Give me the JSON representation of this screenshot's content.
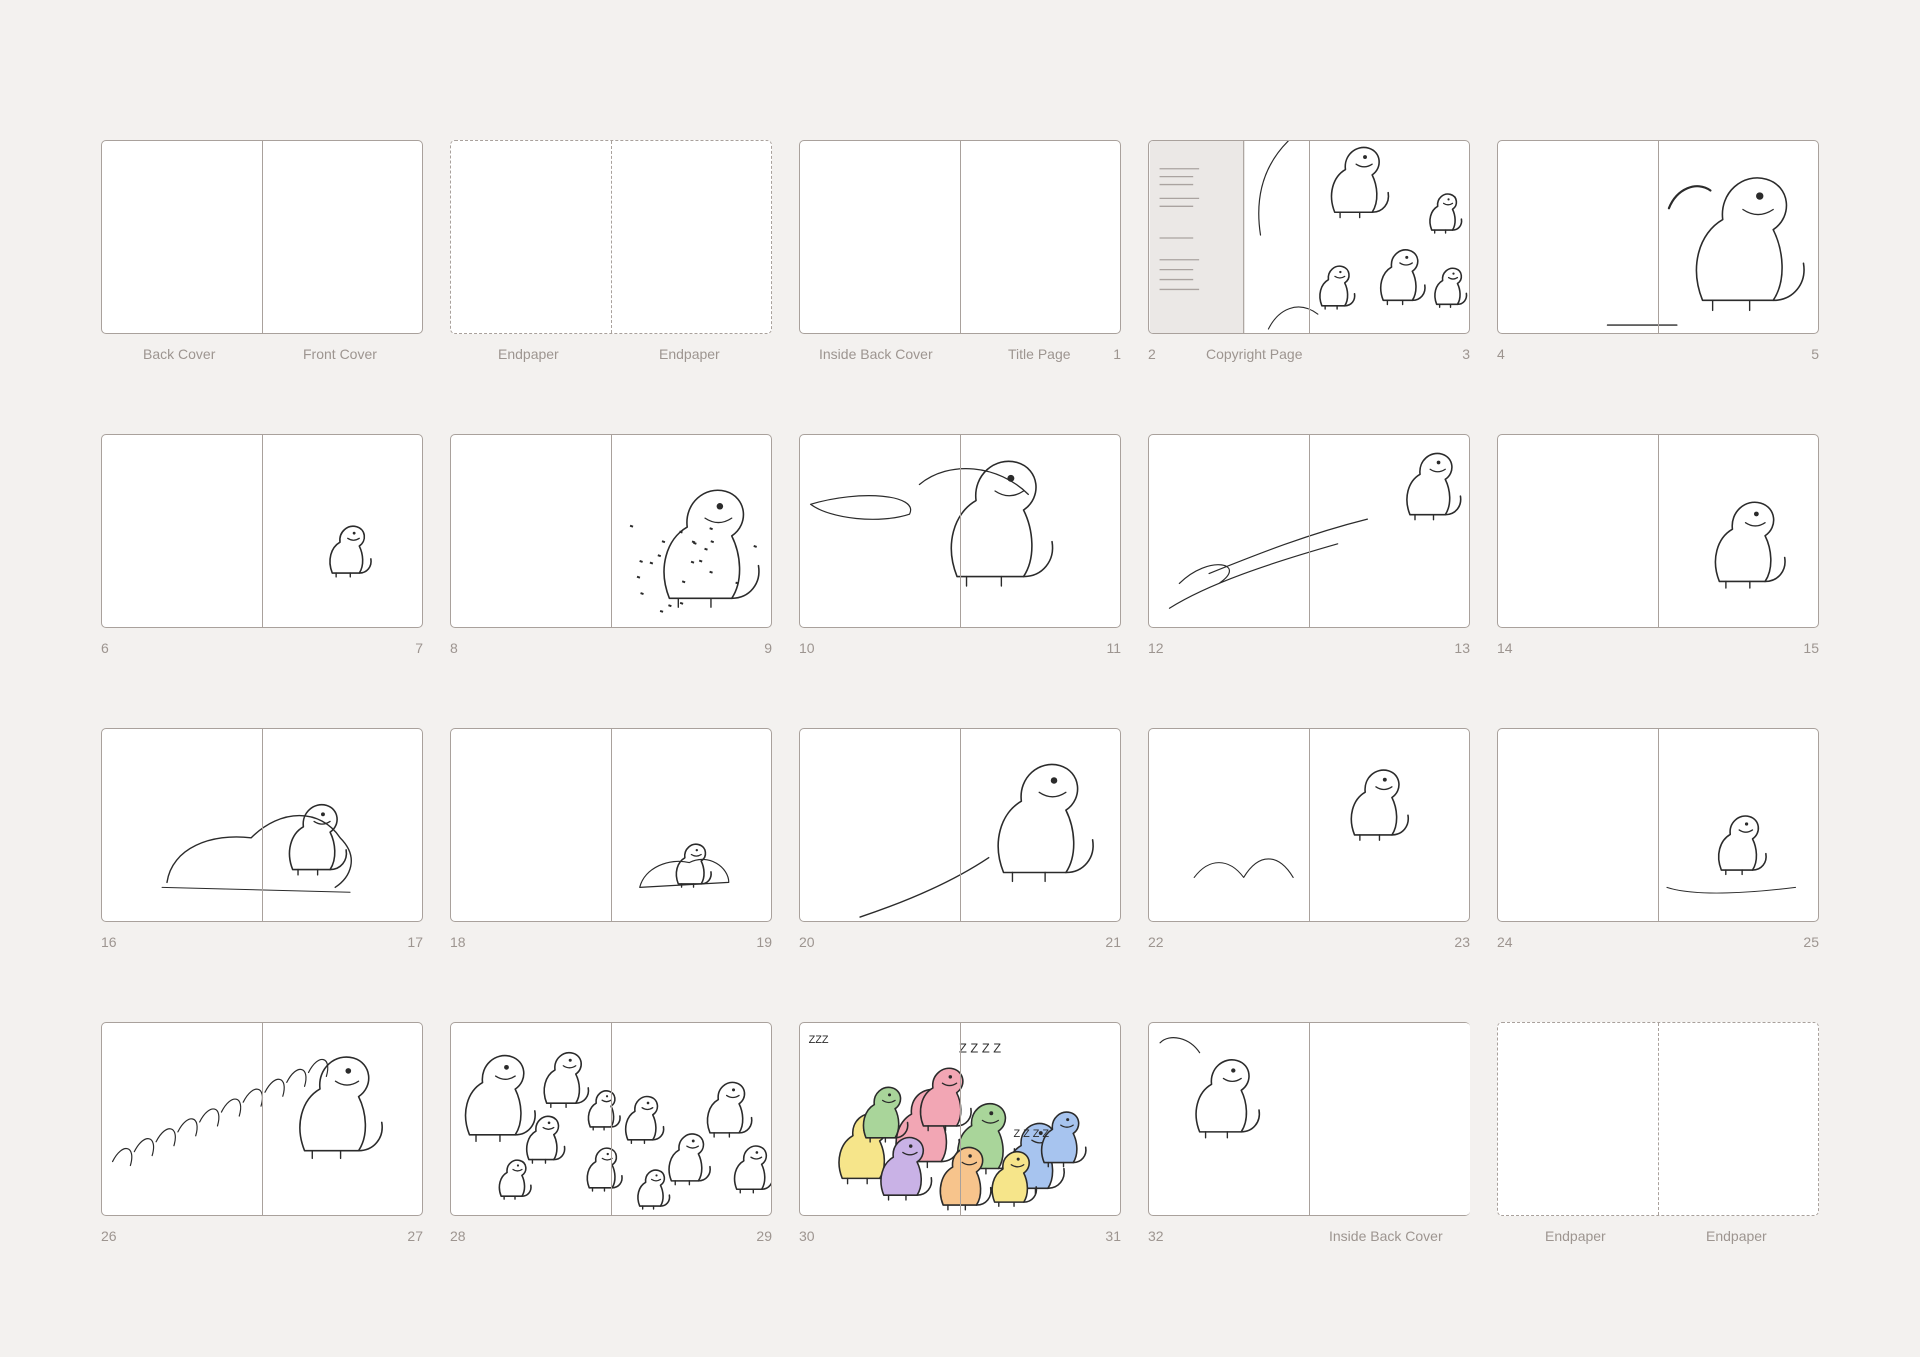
{
  "spreads": [
    {
      "left_label": "Back Cover",
      "right_label": "Front Cover",
      "left_num": "",
      "right_num": "",
      "style": "solid",
      "art": ""
    },
    {
      "left_label": "Endpaper",
      "right_label": "Endpaper",
      "left_num": "",
      "right_num": "",
      "style": "dashed",
      "art": ""
    },
    {
      "left_label": "Inside Back Cover",
      "right_label": "Title Page",
      "left_num": "",
      "right_num": "1",
      "style": "solid",
      "art": ""
    },
    {
      "left_label": "",
      "right_label": "Copyright Page",
      "left_num": "2",
      "right_num": "3",
      "style": "solid",
      "art": "copyright"
    },
    {
      "left_label": "",
      "right_label": "",
      "left_num": "4",
      "right_num": "5",
      "style": "solid",
      "art": "roar"
    },
    {
      "left_label": "",
      "right_label": "",
      "left_num": "6",
      "right_num": "7",
      "style": "solid",
      "art": "small"
    },
    {
      "left_label": "",
      "right_label": "",
      "left_num": "8",
      "right_num": "9",
      "style": "solid",
      "art": "sneeze"
    },
    {
      "left_label": "",
      "right_label": "",
      "left_num": "10",
      "right_num": "11",
      "style": "solid",
      "art": "tumble"
    },
    {
      "left_label": "",
      "right_label": "",
      "left_num": "12",
      "right_num": "13",
      "style": "solid",
      "art": "wind"
    },
    {
      "left_label": "",
      "right_label": "",
      "left_num": "14",
      "right_num": "15",
      "style": "solid",
      "art": "sitting"
    },
    {
      "left_label": "",
      "right_label": "",
      "left_num": "16",
      "right_num": "17",
      "style": "solid",
      "art": "yawn"
    },
    {
      "left_label": "",
      "right_label": "",
      "left_num": "18",
      "right_num": "19",
      "style": "solid",
      "art": "lying"
    },
    {
      "left_label": "",
      "right_label": "",
      "left_num": "20",
      "right_num": "21",
      "style": "solid",
      "art": "bigface"
    },
    {
      "left_label": "",
      "right_label": "",
      "left_num": "22",
      "right_num": "23",
      "style": "solid",
      "art": "jump"
    },
    {
      "left_label": "",
      "right_label": "",
      "left_num": "24",
      "right_num": "25",
      "style": "solid",
      "art": "rolling"
    },
    {
      "left_label": "",
      "right_label": "",
      "left_num": "26",
      "right_num": "27",
      "style": "solid",
      "art": "splash"
    },
    {
      "left_label": "",
      "right_label": "",
      "left_num": "28",
      "right_num": "29",
      "style": "solid",
      "art": "crowd"
    },
    {
      "left_label": "",
      "right_label": "",
      "left_num": "30",
      "right_num": "31",
      "style": "solid",
      "art": "pile"
    },
    {
      "left_label": "",
      "right_label": "Inside Back Cover",
      "left_num": "32",
      "right_num": "",
      "style": "solid-right-dashed",
      "art": "grandpa"
    },
    {
      "left_label": "Endpaper",
      "right_label": "Endpaper",
      "left_num": "",
      "right_num": "",
      "style": "dashed",
      "art": ""
    }
  ],
  "colors": {
    "background": "#f3f1ef",
    "page": "#ffffff",
    "border": "#a9a19c",
    "label": "#9d9590",
    "ink": "#2b2b2b",
    "pile_colors": [
      "#f6e58a",
      "#f2a6b4",
      "#a9d59a",
      "#a7c4ef",
      "#c9b2e6",
      "#f7c48c"
    ]
  }
}
